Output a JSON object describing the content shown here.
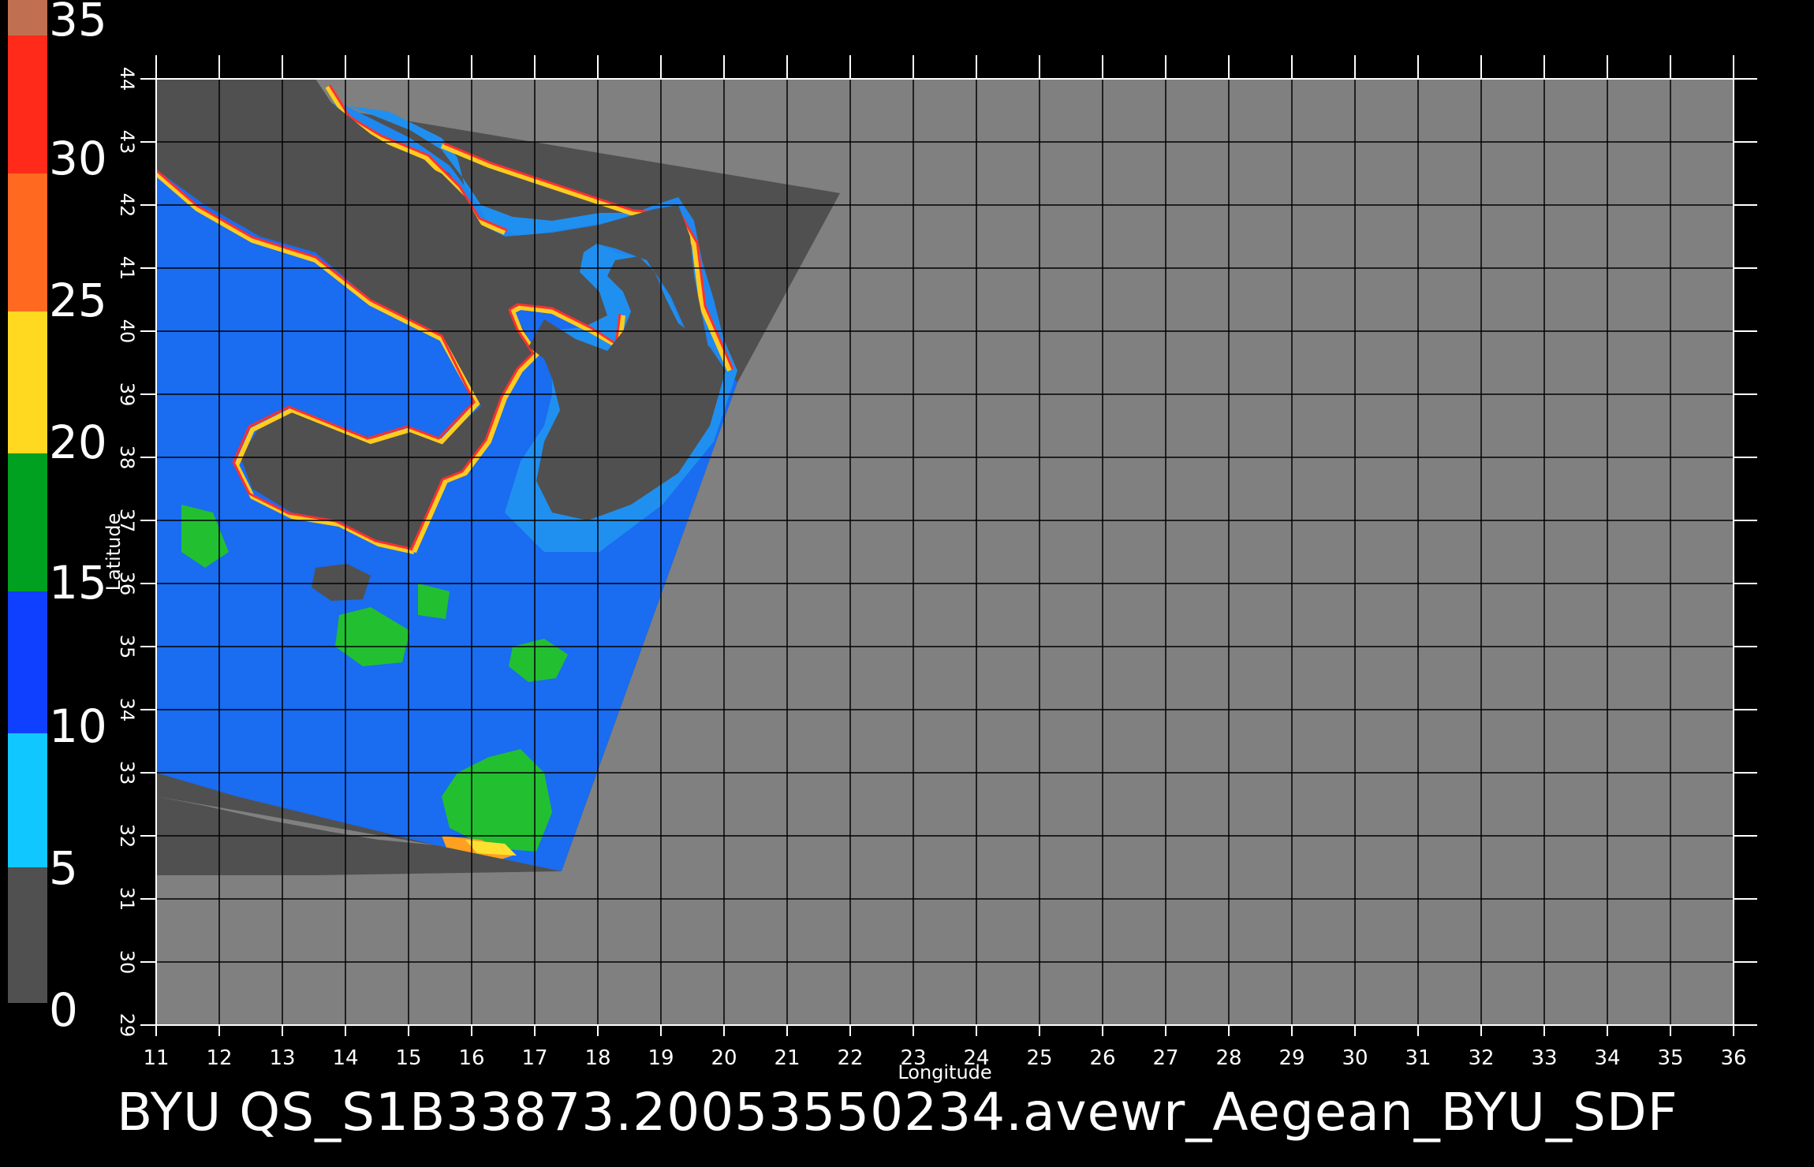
{
  "caption": "BYU  QS_S1B33873.20053550234.avewr_Aegean_BYU_SDF",
  "axes": {
    "x_title": "Longitude",
    "y_title": "Latitude",
    "x_ticks": [
      "11",
      "12",
      "13",
      "14",
      "15",
      "16",
      "17",
      "18",
      "19",
      "20",
      "21",
      "22",
      "23",
      "24",
      "25",
      "26",
      "27",
      "28",
      "29",
      "30",
      "31",
      "32",
      "33",
      "34",
      "35",
      "36"
    ],
    "y_ticks": [
      "29",
      "30",
      "31",
      "32",
      "33",
      "34",
      "35",
      "36",
      "37",
      "38",
      "39",
      "40",
      "41",
      "42",
      "43",
      "44"
    ]
  },
  "colorbar": {
    "labels": [
      "35",
      "30",
      "25",
      "20",
      "15",
      "10",
      "5",
      "0"
    ],
    "colors": {
      "top": "#c07050",
      "red": "#ff2a1a",
      "orange": "#ff7020",
      "yellow": "#ffe020",
      "green": "#00a020",
      "blue": "#1040ff",
      "cyan": "#00e8ff",
      "gray": "#404040"
    }
  },
  "map_colors": {
    "land": "#808080",
    "swath_bg": "#505050",
    "grid": "#000000"
  },
  "chart_data": {
    "type": "heatmap",
    "title": "",
    "xlabel": "Longitude",
    "ylabel": "Latitude",
    "xlim": [
      11,
      36
    ],
    "ylim": [
      29,
      44
    ],
    "colorbar_range": [
      0,
      35
    ],
    "colorbar_ticks": [
      0,
      5,
      10,
      15,
      20,
      25,
      30,
      35
    ],
    "grid": true
  }
}
